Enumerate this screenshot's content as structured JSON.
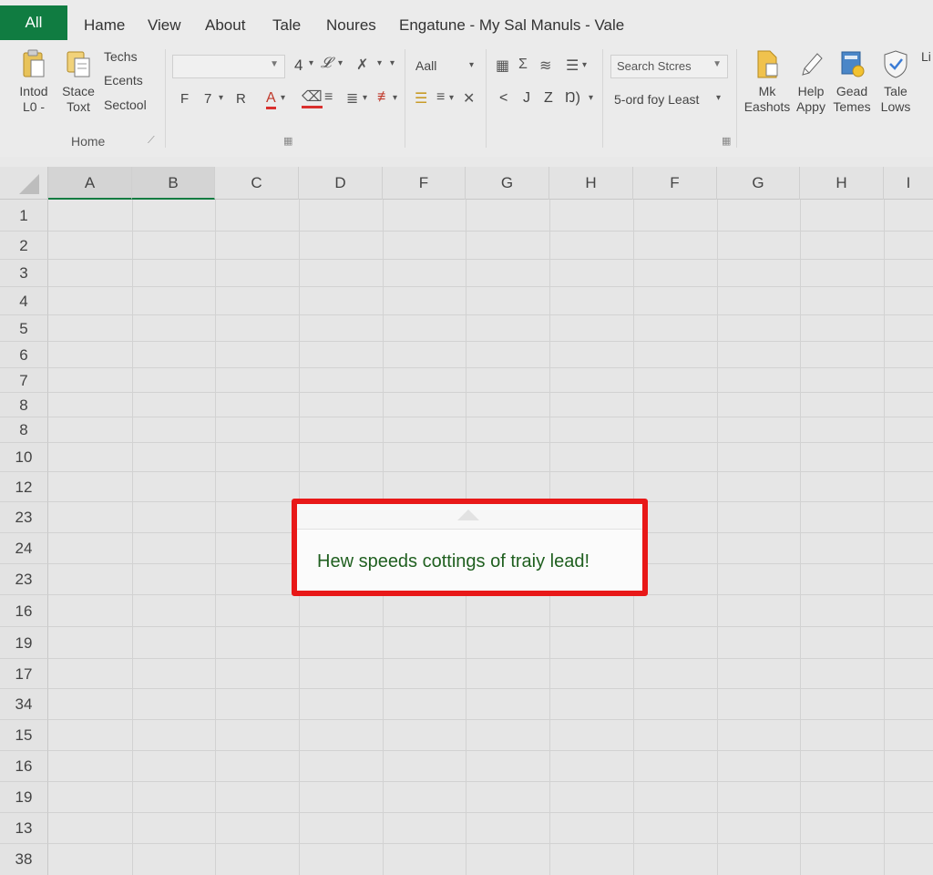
{
  "menubar": {
    "file_tab": "All",
    "items": [
      "Hame",
      "View",
      "About",
      "Tale",
      "Noures"
    ],
    "window_title": "Engatune - My Sal Manuls - Vale"
  },
  "ribbon": {
    "insert_btn": [
      "Intod",
      "L0 -"
    ],
    "slide_text_btn": [
      "Stace",
      "Toxt"
    ],
    "techs": "Techs",
    "ecents": "Ecents",
    "sectool": "Sectool",
    "font_size": "4",
    "font_row2": [
      "F",
      "7",
      "R"
    ],
    "font_color_letter": "A",
    "align_label": "Aall",
    "nav_glyphs": [
      "<",
      "J",
      "Z",
      "Ŋ)"
    ],
    "search_placeholder": "Search Stcres",
    "sort_label": "5-ord foy Least",
    "right_buttons": [
      {
        "name": "mk",
        "line1": "Mk",
        "line2": "Eashots"
      },
      {
        "name": "help",
        "line1": "Help",
        "line2": "Appy"
      },
      {
        "name": "gead",
        "line1": "Gead",
        "line2": "Temes"
      },
      {
        "name": "tale",
        "line1": "Tale",
        "line2": "Lows"
      }
    ],
    "right_cut": "Li",
    "group_home": "Home"
  },
  "grid": {
    "columns": [
      "A",
      "B",
      "C",
      "D",
      "F",
      "G",
      "H",
      "F",
      "G",
      "H",
      "I"
    ],
    "selected_columns": [
      "A",
      "B"
    ],
    "rows": [
      "1",
      "2",
      "3",
      "4",
      "5",
      "6",
      "7",
      "8",
      "8",
      "10",
      "12",
      "23",
      "24",
      "23",
      "16",
      "19",
      "17",
      "34",
      "15",
      "16",
      "19",
      "13",
      "38"
    ]
  },
  "callout": {
    "text": "Hew speeds cottings of traiy lead!"
  },
  "colors": {
    "brand_green": "#107c41",
    "callout_border": "#e81818",
    "callout_text": "#1f5f1f"
  }
}
